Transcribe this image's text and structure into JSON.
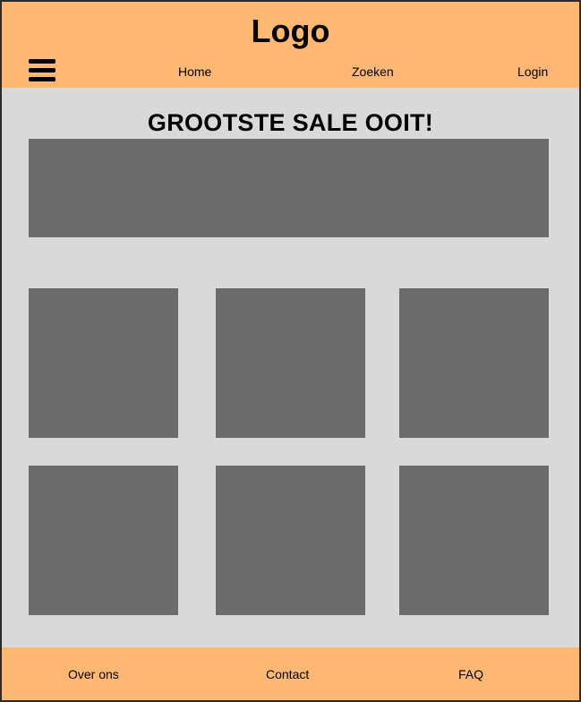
{
  "header": {
    "logo": "Logo",
    "menu_icon": "hamburger-menu-icon",
    "nav": {
      "home": "Home",
      "search": "Zoeken",
      "login": "Login"
    }
  },
  "main": {
    "title": "GROOTSTE SALE OOIT!"
  },
  "footer": {
    "links": {
      "about": "Over ons",
      "contact": "Contact",
      "faq": "FAQ"
    }
  },
  "colors": {
    "accent": "#ffb774",
    "background": "#d9d9d9",
    "placeholder": "#6b6b6b"
  }
}
